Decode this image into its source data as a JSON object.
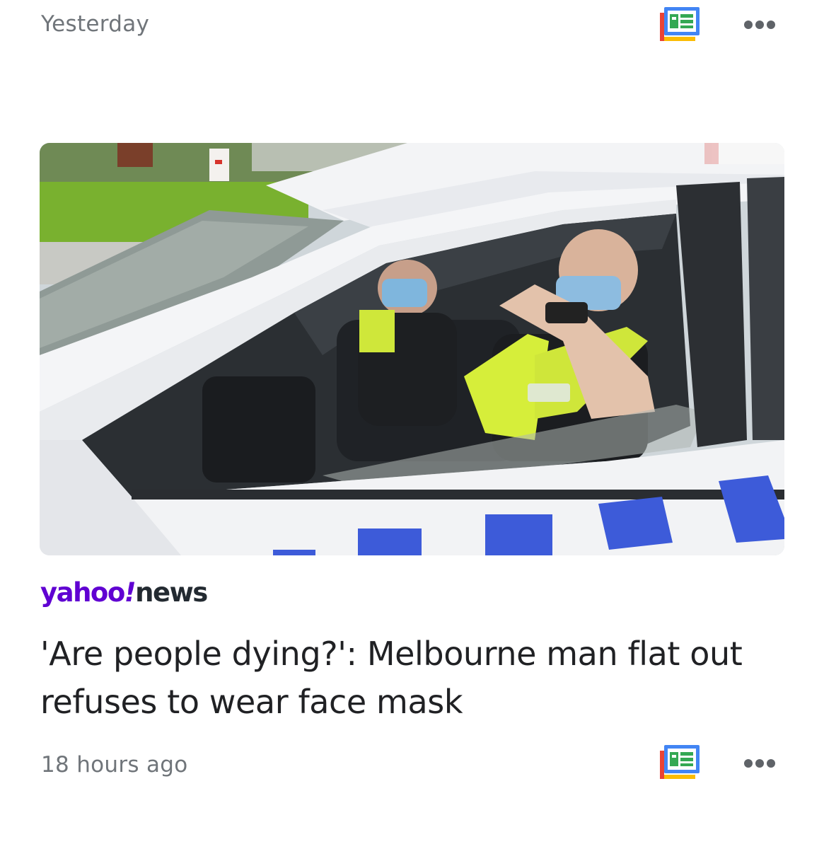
{
  "header": {
    "date_label": "Yesterday",
    "app_icon": "google-news-icon",
    "menu_icon": "more-horizontal-icon"
  },
  "article": {
    "image_description_icon": "news-photo",
    "source": {
      "brand": "yahoo",
      "bang": "!",
      "section": "news",
      "brand_color": "#6001d2"
    },
    "headline": "'Are people dying?': Melbourne man flat out refuses to wear face mask",
    "timestamp": "18 hours ago",
    "app_icon": "google-news-icon",
    "menu_icon": "more-horizontal-icon"
  },
  "colors": {
    "google_blue": "#4285f4",
    "google_red": "#ea4335",
    "google_yellow": "#fbbc04",
    "google_green": "#34a853",
    "police_blue": "#3d5bd9",
    "hi_vis": "#d6ee3a"
  }
}
